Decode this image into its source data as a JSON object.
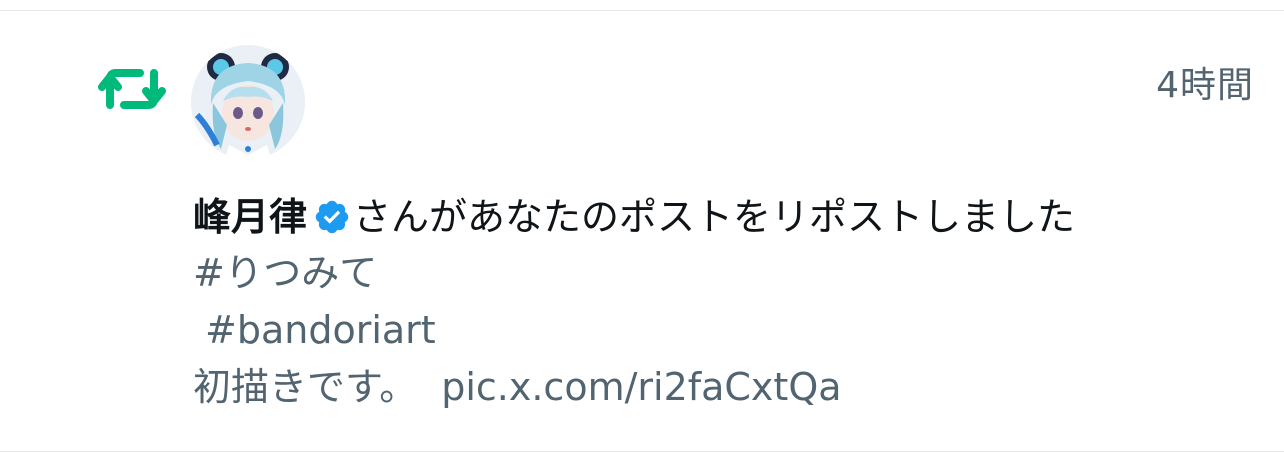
{
  "notification": {
    "type_icon": "repost-icon",
    "timestamp": "4時間",
    "user_name": "峰月律",
    "verified_icon": "verified-badge-icon",
    "action_text": "さんがあなたのポストをリポストしました",
    "post": {
      "hashtag1": "#りつみて",
      "hashtag2": "#bandoriart",
      "body": "初描きです。",
      "link": "pic.x.com/ri2faCxtQa"
    }
  },
  "colors": {
    "repost_green": "#00ba7c",
    "verified_blue": "#1d9bf0",
    "primary_text": "#0f1419",
    "secondary_text": "#536471"
  }
}
